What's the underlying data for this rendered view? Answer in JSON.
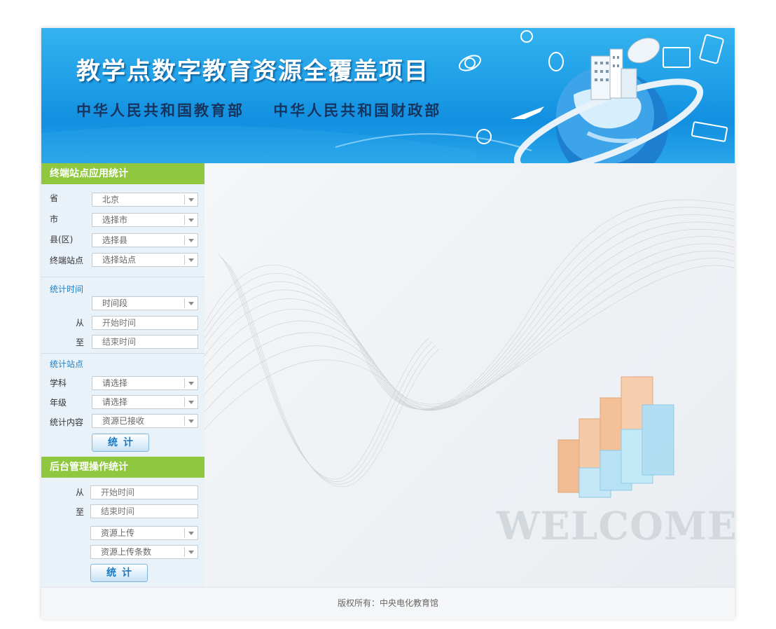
{
  "banner": {
    "title": "教学点数字教育资源全覆盖项目",
    "subtitle": "中华人民共和国教育部    中华人民共和国财政部"
  },
  "terminal_stats": {
    "header": "终端站点应用统计",
    "province_label": "省",
    "province_value": "北京",
    "city_label": "市",
    "city_value": "选择市",
    "county_label": "县(区)",
    "county_value": "选择县",
    "site_label": "终端站点",
    "site_value": "选择站点",
    "time_header": "统计时间",
    "period_value": "时间段",
    "from_label": "从",
    "from_placeholder": "开始时间",
    "to_label": "至",
    "to_placeholder": "结束时间",
    "site_header": "统计站点",
    "subject_label": "学科",
    "subject_value": "请选择",
    "grade_label": "年级",
    "grade_value": "请选择",
    "content_label": "统计内容",
    "content_value": "资源已接收",
    "button_label": "统计"
  },
  "backend_stats": {
    "header": "后台管理操作统计",
    "from_label": "从",
    "from_placeholder": "开始时间",
    "to_label": "至",
    "to_placeholder": "结束时间",
    "operation_value": "资源上传",
    "metric_value": "资源上传条数",
    "button_label": "统计"
  },
  "main": {
    "welcome_text": "WELCOME"
  },
  "footer": {
    "copyright": "版权所有：中央电化教育馆"
  },
  "colors": {
    "banner_blue": "#1d9de6",
    "section_green": "#8fc73e",
    "sublabel_blue": "#1c7fc6"
  }
}
